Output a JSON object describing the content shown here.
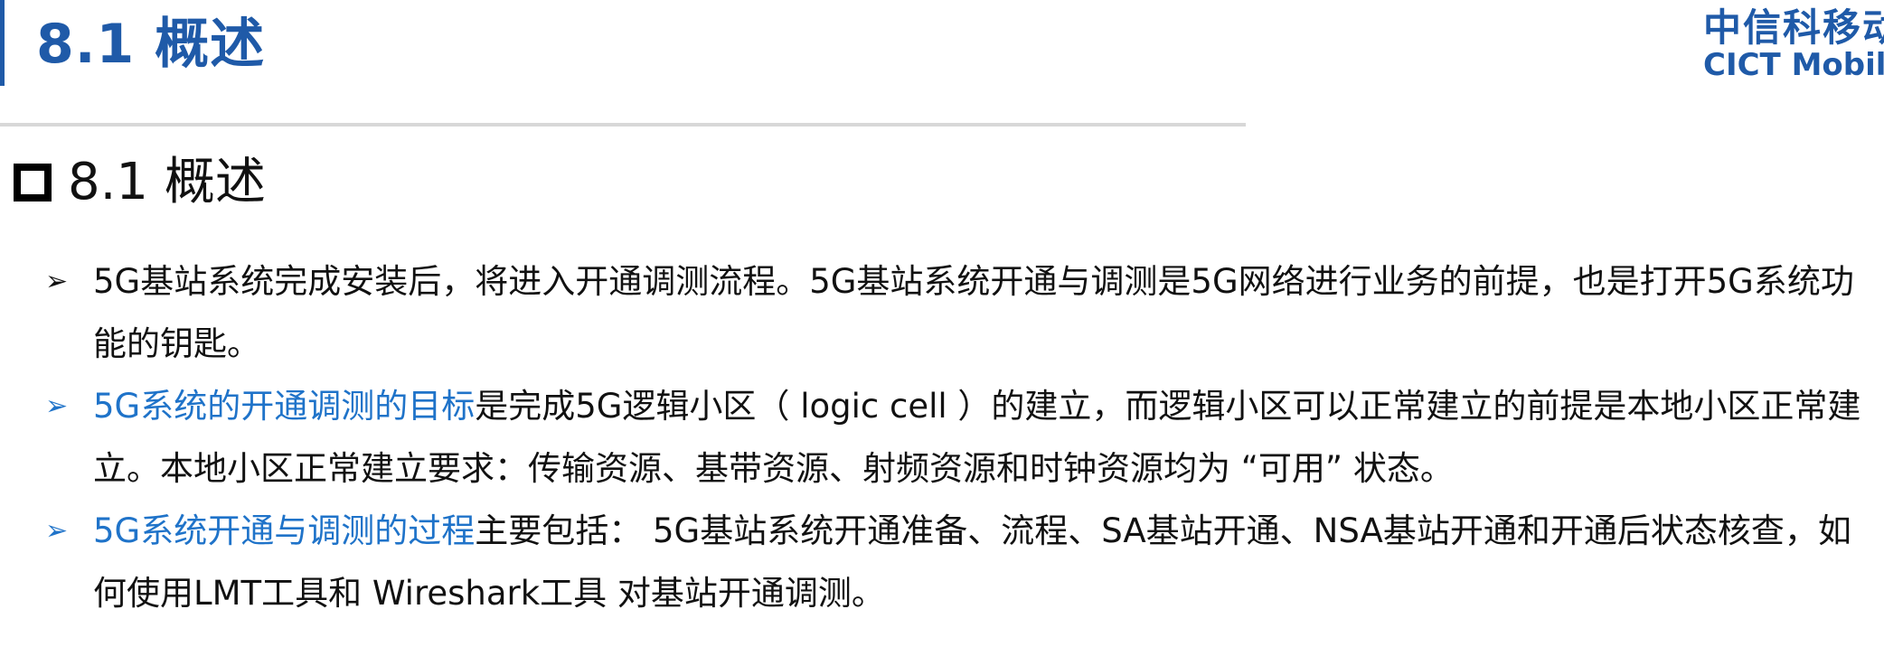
{
  "header": {
    "title": "8.1 概述",
    "logo_cn": "中信科移动",
    "logo_en": "CICT Mobile"
  },
  "section": {
    "title": "8.1 概述"
  },
  "bullets": [
    {
      "marker": "➢",
      "highlight": "",
      "text": "5G基站系统完成安装后，将进入开通调测流程。5G基站系统开通与调测是5G网络进行业务的前提，也是打开5G系统功能的钥匙。"
    },
    {
      "marker": "➢",
      "highlight": "5G系统的开通调测的目标",
      "text": "是完成5G逻辑小区（ logic cell ）的建立，而逻辑小区可以正常建立的前提是本地小区正常建立。本地小区正常建立要求：传输资源、基带资源、射频资源和时钟资源均为 “可用” 状态。"
    },
    {
      "marker": "➢",
      "highlight": "5G系统开通与调测的过程",
      "text": "主要包括： 5G基站系统开通准备、流程、SA基站开通、NSA基站开通和开通后状态核查，如何使用LMT工具和 Wireshark工具 对基站开通调测。"
    }
  ],
  "colors": {
    "brand_blue": "#1f5aa8",
    "highlight_blue": "#1f73c9",
    "rule_gray": "#d8d8d8"
  }
}
